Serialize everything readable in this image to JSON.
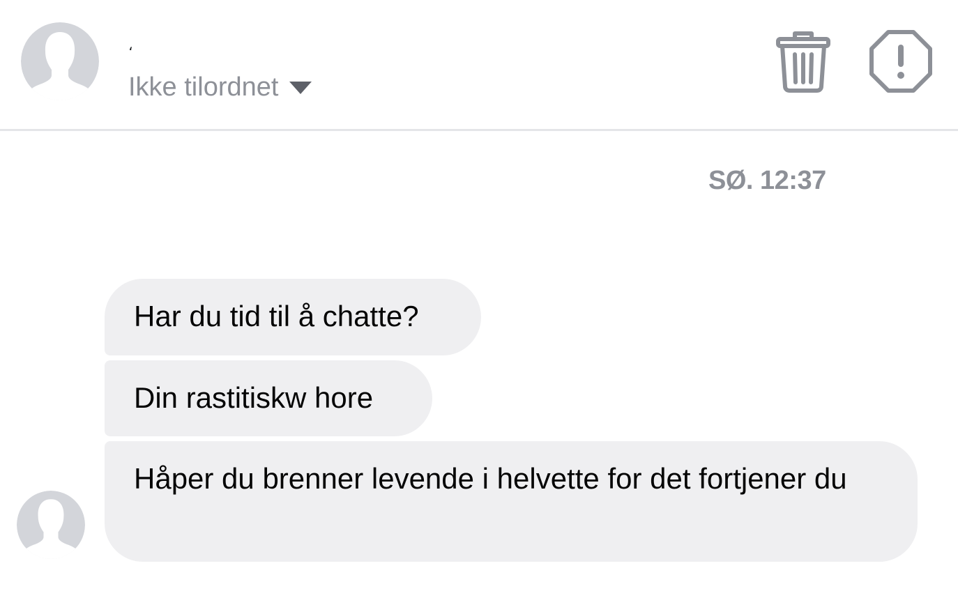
{
  "header": {
    "contact_name": "،",
    "assign_label": "Ikke tilordnet",
    "icons": {
      "avatar": "avatar-placeholder-icon",
      "caret": "caret-down-icon",
      "delete": "trash-icon",
      "report": "report-octagon-icon"
    }
  },
  "conversation": {
    "timestamp": "SØ. 12:37",
    "messages": [
      {
        "text": "Har du tid til å chatte?"
      },
      {
        "text": "Din rastitiskw hore"
      },
      {
        "text": "Håper du brenner levende i helvette for det fortjener du"
      }
    ]
  },
  "colors": {
    "bubble_bg": "#efeff1",
    "secondary_text": "#8d9097",
    "divider": "#e4e5e8",
    "avatar": "#d3d5da",
    "icon": "#8d9097"
  }
}
